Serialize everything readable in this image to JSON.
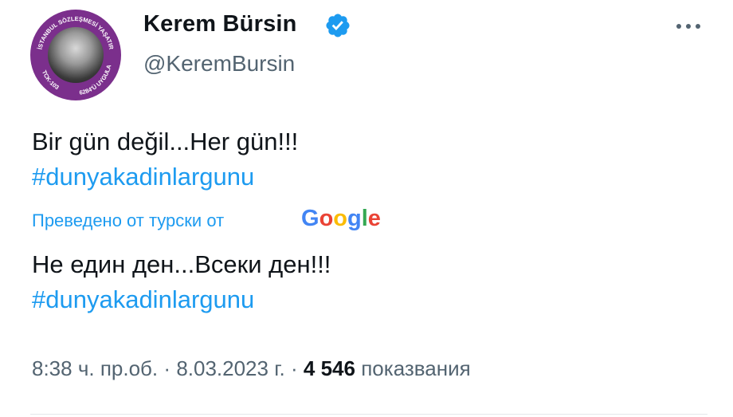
{
  "author": {
    "display_name": "Kerem Bürsin",
    "handle": "@KeremBursin",
    "verified": true,
    "avatar_ring_text_top": "İSTANBUL SÖZLEŞMESİ YAŞATIR",
    "avatar_ring_text_left": "TCK-103",
    "avatar_ring_text_right": "6284'Ü UYGULA"
  },
  "tweet": {
    "original_line_1": "Bir gün değil...Her gün!!!",
    "original_hashtag": "#dunyakadinlargunu",
    "translation_notice": "Преведено от турски от",
    "translation_provider": "Google",
    "translated_line_1": "Не един ден...Всеки ден!!!",
    "translated_hashtag": "#dunyakadinlargunu"
  },
  "meta": {
    "time": "8:38 ч. пр.об.",
    "separator": "·",
    "date": "8.03.2023 г.",
    "views_count": "4 546",
    "views_label": "показвания"
  },
  "icons": {
    "verified": "verified-badge-icon",
    "more": "more-options-icon"
  },
  "colors": {
    "link_blue": "#1d9bf0",
    "text_primary": "#0f1419",
    "text_secondary": "#536471",
    "avatar_ring": "#7b2f8c",
    "google_blue": "#4285F4",
    "google_red": "#EA4335",
    "google_yellow": "#FBBC05",
    "google_green": "#34A853"
  }
}
